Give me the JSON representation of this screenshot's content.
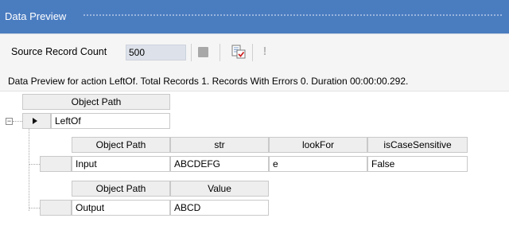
{
  "window": {
    "title": "Data Preview"
  },
  "toolbar": {
    "source_record_label": "Source Record Count",
    "source_record_value": "500",
    "stop_icon": "stop-icon",
    "preview_icon": "document-check-icon",
    "error_icon": "exclamation-icon"
  },
  "status": {
    "text": "Data Preview for action LeftOf. Total Records 1. Records With Errors 0. Duration 00:00:00.292."
  },
  "tree": {
    "root": {
      "header": "Object Path",
      "value": "LeftOf",
      "expanded": true
    },
    "children": [
      {
        "headers": [
          "Object Path",
          "str",
          "lookFor",
          "isCaseSensitive"
        ],
        "row": [
          "Input",
          "ABCDEFG",
          "e",
          "False"
        ]
      },
      {
        "headers": [
          "Object Path",
          "Value"
        ],
        "row": [
          "Output",
          "ABCD"
        ]
      }
    ]
  },
  "colors": {
    "titlebar": "#4a7cc0",
    "toolbar_bg": "#f5f5f5",
    "header_bg": "#eeeeee",
    "grid_border": "#c9c9c9"
  }
}
